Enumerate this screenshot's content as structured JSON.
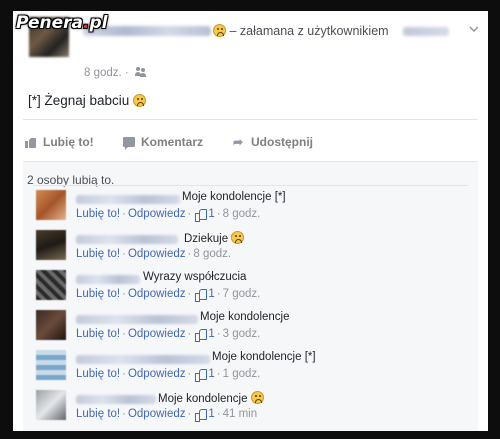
{
  "watermark": {
    "name": "Penera",
    "dot": ".",
    "tld": "pl"
  },
  "post": {
    "feeling_text": "– załamana z użytkownikiem",
    "time": "8 godz. ·",
    "content": "[*] Żegnaj babciu"
  },
  "actions": {
    "like": "Lubię to!",
    "comment": "Komentarz",
    "share": "Udostępnij"
  },
  "likes_summary": "2 osoby lubią to.",
  "comment_actions": {
    "like": "Lubię to!",
    "reply": "Odpowiedz"
  },
  "comments": [
    {
      "text": "Moje kondolencje [*]",
      "likes": "1",
      "time": "8 godz."
    },
    {
      "text": "Dziekuje",
      "likes": "",
      "time": "8 godz."
    },
    {
      "text": "Wyrazy współczucia",
      "likes": "1",
      "time": "7 godz."
    },
    {
      "text": "Moje kondolencje",
      "likes": "1",
      "time": "3 godz."
    },
    {
      "text": "Moje kondolencje [*]",
      "likes": "1",
      "time": "1 godz."
    },
    {
      "text": "Moje kondolencje",
      "likes": "1",
      "time": "41 min"
    }
  ],
  "colors": {
    "link": "#4267b2",
    "meta": "#90949c",
    "watermark_dot": "#e7313a"
  }
}
